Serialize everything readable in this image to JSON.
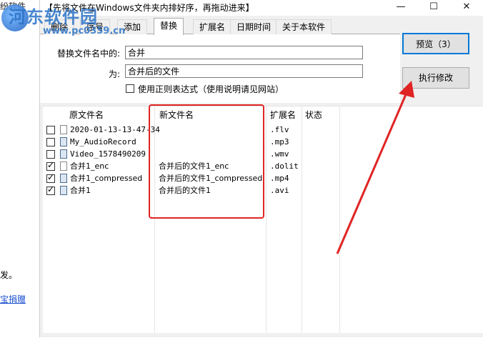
{
  "left_window": {
    "title_fragment": "纷软件",
    "text_fragment": "发。",
    "link_fragment": "宝捐赠"
  },
  "window": {
    "title": "【先将文件在Windows文件夹内排好序，再拖动进来】",
    "controls": {
      "minimize": "—",
      "maximize": "☐",
      "close": "✕"
    }
  },
  "watermark": {
    "text": "河东软件园",
    "url": "www.pc0359.cn"
  },
  "tabs": [
    {
      "label": "删除",
      "active": false
    },
    {
      "label": "序号",
      "active": false
    },
    {
      "label": "添加",
      "active": false
    },
    {
      "label": "替换",
      "active": true
    },
    {
      "label": "扩展名",
      "active": false
    },
    {
      "label": "日期时间",
      "active": false
    },
    {
      "label": "关于本软件",
      "active": false
    }
  ],
  "replace_panel": {
    "find_label": "替换文件名中的:",
    "find_value": "合并",
    "replace_label": "为:",
    "replace_value": "合并后的文件",
    "regex_label": "使用正则表达式（使用说明请见网站）",
    "regex_checked": false
  },
  "buttons": {
    "preview": "预览（3）",
    "execute": "执行修改"
  },
  "table": {
    "headers": {
      "original": "原文件名",
      "new": "新文件名",
      "ext": "扩展名",
      "status": "状态"
    },
    "rows": [
      {
        "checked": false,
        "icon": "file-icon",
        "original": "2020-01-13-13-47-34",
        "new": "",
        "ext": ".flv",
        "status": ""
      },
      {
        "checked": false,
        "icon": "audio-file-icon",
        "original": "My_AudioRecord",
        "new": "",
        "ext": ".mp3",
        "status": ""
      },
      {
        "checked": false,
        "icon": "video-file-icon",
        "original": "Video_1578490209",
        "new": "",
        "ext": ".wmv",
        "status": ""
      },
      {
        "checked": true,
        "icon": "file-icon",
        "original": "合并1_enc",
        "new": "合并后的文件1_enc",
        "ext": ".dolit",
        "status": ""
      },
      {
        "checked": true,
        "icon": "video-file-icon",
        "original": "合并1_compressed",
        "new": "合并后的文件1_compressed",
        "ext": ".mp4",
        "status": ""
      },
      {
        "checked": true,
        "icon": "video-file-icon",
        "original": "合并1",
        "new": "合并后的文件1",
        "ext": ".avi",
        "status": ""
      }
    ]
  },
  "colors": {
    "annotation": "#e02424",
    "accent": "#0078d7",
    "watermark": "#2a73c8"
  }
}
